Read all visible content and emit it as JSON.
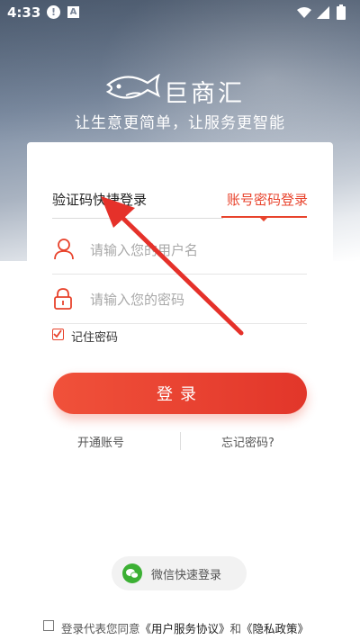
{
  "status_bar": {
    "time": "4:33",
    "icons": [
      "alert-icon",
      "a-box-icon",
      "wifi-icon",
      "signal-icon",
      "battery-icon"
    ]
  },
  "brand": {
    "logo_text": "巨商汇",
    "slogan": "让生意更简单，让服务更智能"
  },
  "tabs": {
    "sms_login": "验证码快捷登录",
    "password_login": "账号密码登录",
    "active": "password_login"
  },
  "form": {
    "username_placeholder": "请输入您的用户名",
    "password_placeholder": "请输入您的密码",
    "remember_label": "记住密码",
    "remember_checked": true,
    "login_button": "登录"
  },
  "links": {
    "open_account": "开通账号",
    "forgot_password": "忘记密码?"
  },
  "wechat_login": "微信快速登录",
  "agreement": {
    "prefix": "登录代表您同意",
    "terms": "《用户服务协议》",
    "and": "和",
    "privacy": "《隐私政策》"
  },
  "colors": {
    "accent": "#e8432c",
    "wechat_green": "#3cb034"
  }
}
